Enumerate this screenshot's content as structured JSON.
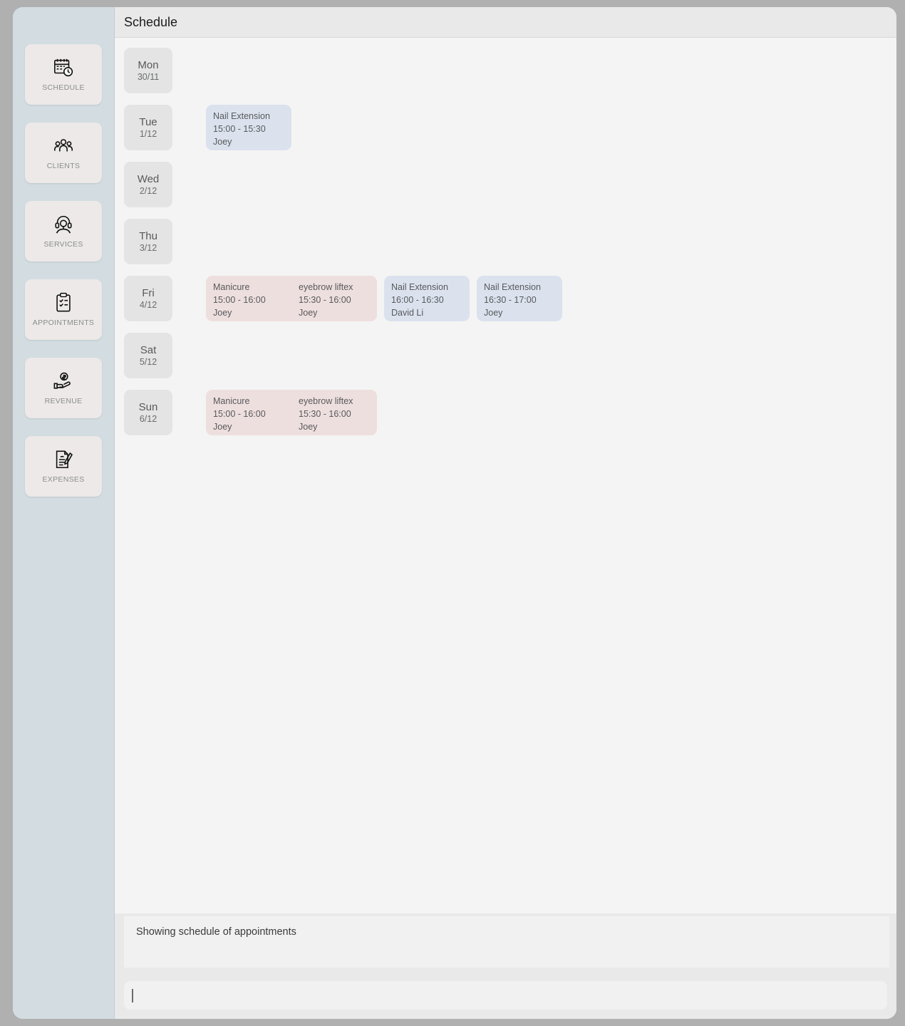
{
  "window": {
    "title": "Schedule"
  },
  "sidebar": {
    "items": [
      {
        "label": "SCHEDULE",
        "icon": "calendar-clock-icon"
      },
      {
        "label": "CLIENTS",
        "icon": "people-group-icon"
      },
      {
        "label": "SERVICES",
        "icon": "headset-agent-icon"
      },
      {
        "label": "APPOINTMENTS",
        "icon": "clipboard-check-icon"
      },
      {
        "label": "REVENUE",
        "icon": "hand-holding-coin-icon"
      },
      {
        "label": "EXPENSES",
        "icon": "invoice-pen-icon"
      }
    ]
  },
  "schedule": {
    "days": [
      {
        "name": "Mon",
        "date": "30/11",
        "groups": []
      },
      {
        "name": "Tue",
        "date": "1/12",
        "groups": [
          {
            "color": "blue",
            "appointments": [
              {
                "service": "Nail Extension",
                "time": "15:00 - 15:30",
                "staff": "Joey"
              }
            ]
          }
        ]
      },
      {
        "name": "Wed",
        "date": "2/12",
        "groups": []
      },
      {
        "name": "Thu",
        "date": "3/12",
        "groups": []
      },
      {
        "name": "Fri",
        "date": "4/12",
        "groups": [
          {
            "color": "pink",
            "appointments": [
              {
                "service": "Manicure",
                "time": "15:00 - 16:00",
                "staff": "Joey"
              },
              {
                "service": "eyebrow liftex",
                "time": "15:30 - 16:00",
                "staff": "Joey"
              }
            ]
          },
          {
            "color": "blue",
            "appointments": [
              {
                "service": "Nail Extension",
                "time": "16:00 - 16:30",
                "staff": "David Li"
              }
            ]
          },
          {
            "color": "blue",
            "appointments": [
              {
                "service": "Nail Extension",
                "time": "16:30 - 17:00",
                "staff": "Joey"
              }
            ]
          }
        ]
      },
      {
        "name": "Sat",
        "date": "5/12",
        "groups": []
      },
      {
        "name": "Sun",
        "date": "6/12",
        "groups": [
          {
            "color": "pink",
            "appointments": [
              {
                "service": "Manicure",
                "time": "15:00 - 16:00",
                "staff": "Joey"
              },
              {
                "service": "eyebrow liftex",
                "time": "15:30 - 16:00",
                "staff": "Joey"
              }
            ]
          }
        ]
      }
    ]
  },
  "status": {
    "message": "Showing schedule of appointments"
  },
  "command_input": {
    "value": "",
    "placeholder": ""
  },
  "colors": {
    "frame": "#b0b0b0",
    "sidebar_bg": "#d3dde1",
    "nav_accent": "#9cc0dd",
    "nav_button": "#ece9e8",
    "content_bg": "#f4f4f4",
    "panel_bg": "#e9e9e9",
    "appointment_pink": "#eedfdf",
    "appointment_blue": "#dbe2ee",
    "day_chip": "#e4e4e4"
  }
}
